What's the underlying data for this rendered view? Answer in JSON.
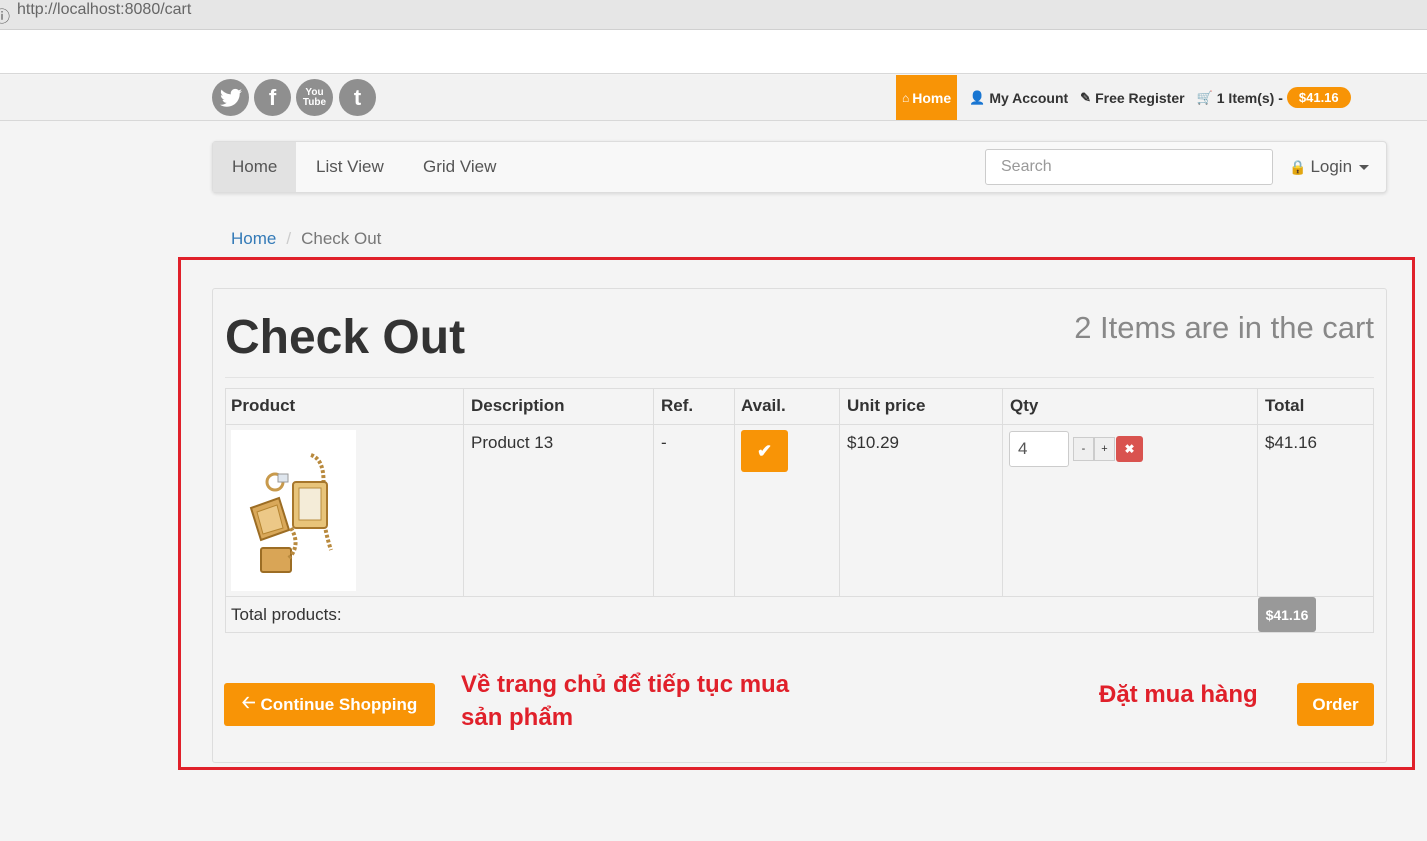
{
  "browser": {
    "url": "http://localhost:8080/cart"
  },
  "social": [
    "twitter",
    "facebook",
    "youtube",
    "tumblr"
  ],
  "topnav": {
    "home": "Home",
    "account": "My Account",
    "register": "Free Register",
    "cart_items": "1 Item(s) -",
    "cart_amount": "$41.16"
  },
  "navbar": {
    "items": [
      "Home",
      "List View",
      "Grid View"
    ],
    "search_placeholder": "Search",
    "login": "Login"
  },
  "breadcrumb": {
    "home": "Home",
    "current": "Check Out"
  },
  "checkout": {
    "title": "Check Out",
    "count": "2 Items are in the cart",
    "headers": [
      "Product",
      "Description",
      "Ref.",
      "Avail.",
      "Unit price",
      "Qty",
      "Total"
    ],
    "row": {
      "description": "Product 13",
      "ref": "-",
      "unit_price": "$10.29",
      "qty": "4",
      "total": "$41.16"
    },
    "total_label": "Total products:",
    "total_value": "$41.16",
    "qty_minus": "-",
    "qty_plus": "+"
  },
  "buttons": {
    "continue": "Continue Shopping",
    "order": "Order"
  },
  "annotations": {
    "continue_note_1": "Về trang chủ để tiếp tục mua",
    "continue_note_2": "sản phẩm",
    "order_note": "Đặt mua hàng"
  },
  "colors": {
    "accent": "#f89406",
    "annotation": "#e0202a",
    "danger": "#d9534f"
  }
}
